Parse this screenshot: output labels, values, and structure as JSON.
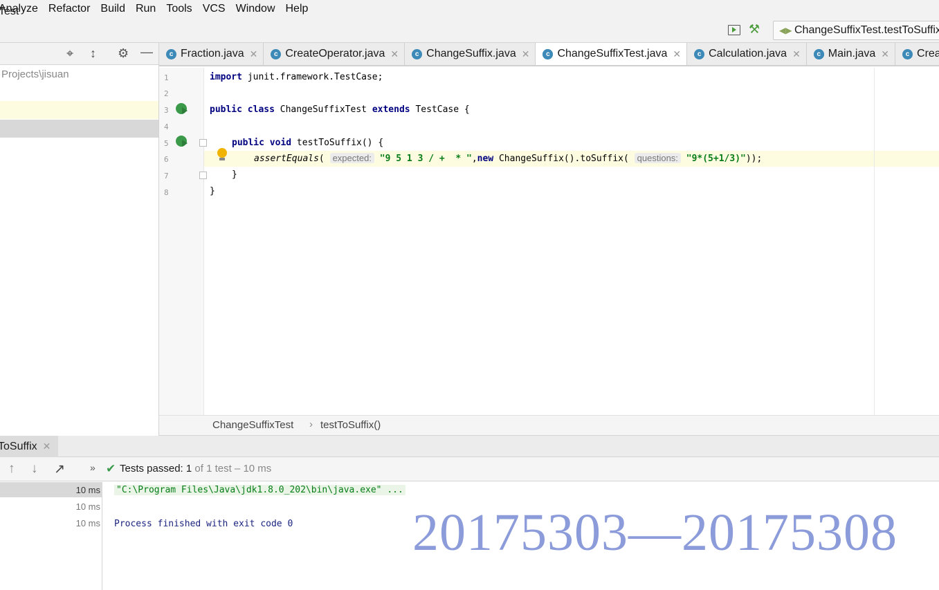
{
  "menu": [
    "Analyze",
    "Refactor",
    "Build",
    "Run",
    "Tools",
    "VCS",
    "Window",
    "Help"
  ],
  "nav": {
    "title": "Test",
    "run_config": "ChangeSuffixTest.testToSuffix"
  },
  "project": {
    "path": "Projects\\jisuan"
  },
  "tabs": [
    {
      "label": "Fraction.java"
    },
    {
      "label": "CreateOperator.java"
    },
    {
      "label": "ChangeSuffix.java"
    },
    {
      "label": "ChangeSuffixTest.java",
      "active": true
    },
    {
      "label": "Calculation.java"
    },
    {
      "label": "Main.java"
    },
    {
      "label": "Creat"
    }
  ],
  "editor": {
    "line_numbers": [
      "1",
      "2",
      "3",
      "4",
      "5",
      "6",
      "7",
      "8"
    ],
    "line1": {
      "kw": "import",
      "rest": " junit.framework.TestCase;"
    },
    "line3": {
      "kw1": "public",
      "kw2": "class",
      "name": " ChangeSuffixTest ",
      "kw3": "extends",
      "rest": " TestCase {"
    },
    "line5": {
      "kw1": "public",
      "kw2": "void",
      "rest": " testToSuffix() {"
    },
    "line6": {
      "call": "assertEquals",
      "open": "(",
      "hint1": "expected:",
      "str1": "\"9 5 1 3 / +  * \"",
      "comma": ",",
      "kw": "new",
      "mid": " ChangeSuffix().toSuffix(",
      "hint2": "questions:",
      "str2": "\"9*(5+1/3)\"",
      "end": "));"
    },
    "line7": "}",
    "line8": "}"
  },
  "breadcrumb": {
    "class": "ChangeSuffixTest",
    "sep": "›",
    "method": "testToSuffix()"
  },
  "run_panel": {
    "tab_label": "ToSuffix",
    "tests_passed_label": "Tests passed:",
    "passed": "1",
    "rest": " of 1 test – 10 ms",
    "durations": [
      "10 ms",
      "10 ms",
      "10 ms"
    ],
    "cmd": "\"C:\\Program Files\\Java\\jdk1.8.0_202\\bin\\java.exe\" ...",
    "exit": "Process finished with exit code 0"
  },
  "watermark": "20175303—20175308",
  "colors": {
    "keyword": "#000080",
    "string": "#067d17",
    "accent": "#3d8ab8",
    "pass": "#3a9a4a",
    "watermark": "#8c9bd9"
  }
}
